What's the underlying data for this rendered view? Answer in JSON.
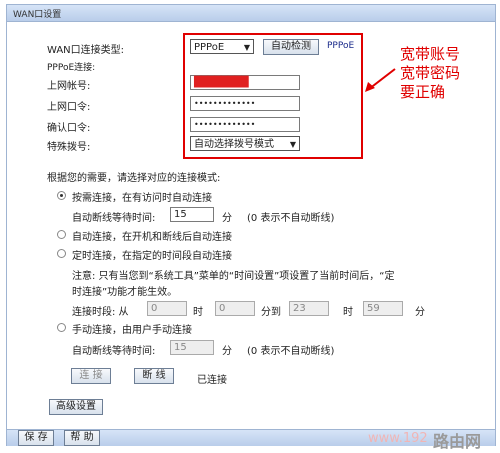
{
  "window": {
    "title": "WAN口设置"
  },
  "form": {
    "conn_type_label": "WAN口连接类型:",
    "conn_type_value": "PPPoE",
    "auto_detect_button": "自动检测",
    "conn_type_hint": "PPPoE",
    "pppoe_section": "PPPoE连接:",
    "account_label": "上网帐号:",
    "account_value": "████████",
    "password_label": "上网口令:",
    "password_value": "•••••••••••••",
    "confirm_label": "确认口令:",
    "confirm_value": "•••••••••••••",
    "dial_label": "特殊拨号:",
    "dial_value": "自动选择拨号模式"
  },
  "annotation": {
    "lines": [
      "宽带账号",
      "宽带密码",
      "要正确"
    ]
  },
  "mode": {
    "heading": "根据您的需要，请选择对应的连接模式:",
    "opt1": "按需连接，在有访问时自动连接",
    "idle_label": "自动断线等待时间:",
    "idle_value": "15",
    "minutes": "分",
    "idle_hint": "(0 表示不自动断线)",
    "opt2": "自动连接，在开机和断线后自动连接",
    "opt3": "定时连接，在指定的时间段自动连接",
    "note_line1": "注意: 只有当您到“系统工具”菜单的“时间设置”项设置了当前时间后，“定",
    "note_line2": "时连接”功能才能生效。",
    "period_label": "连接时段: 从",
    "from_hour": "0",
    "hour": "时",
    "from_min": "0",
    "to": "分到",
    "to_hour": "23",
    "to_min": "59",
    "opt4": "手动连接，由用户手动连接",
    "idle2_value": "15"
  },
  "actions": {
    "connect": "连 接",
    "disconnect": "断 线",
    "status": "已连接",
    "advanced": "高级设置",
    "save": "保 存",
    "help": "帮 助"
  },
  "watermark": {
    "left": "www.192",
    "right": "路由网"
  }
}
